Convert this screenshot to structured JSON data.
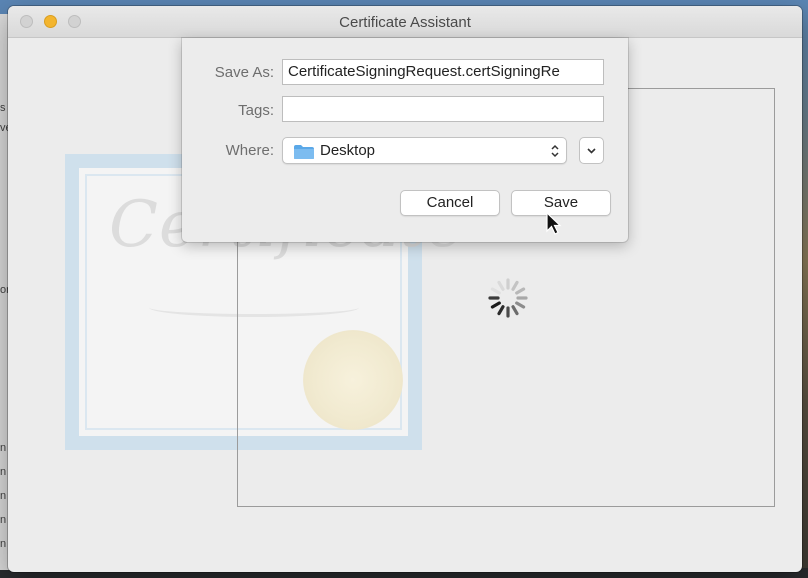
{
  "window": {
    "title": "Certificate Assistant"
  },
  "save_sheet": {
    "save_as_label": "Save As:",
    "save_as_value": "CertificateSigningRequest.certSigningRe",
    "tags_label": "Tags:",
    "tags_value": "",
    "where_label": "Where:",
    "where_value": "Desktop",
    "cancel_label": "Cancel",
    "save_label": "Save"
  },
  "background_window": {
    "visible_fragments": [
      "s",
      "ve",
      "or",
      "n",
      "n",
      "n",
      "n",
      "n"
    ]
  },
  "icons": {
    "folder": "folder-icon",
    "popup_arrows": "updown-chevron-icon",
    "expand": "chevron-down-icon",
    "spinner": "spinner-icon",
    "cursor": "mouse-pointer-icon"
  },
  "colors": {
    "folder_blue": "#5aa8e8",
    "window_bg": "#ececec",
    "minimize_yellow": "#f3b52f"
  }
}
